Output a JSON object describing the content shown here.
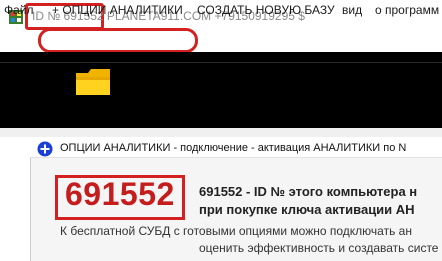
{
  "window": {
    "title": "ID № 691552 PLANETA911.COM +79150919295 $"
  },
  "menu": {
    "items": [
      {
        "label": "Файл"
      },
      {
        "label": "+ ОПЦИИ АНАЛИТИКИ"
      },
      {
        "label": "СОЗДАТЬ НОВУЮ БАЗУ"
      },
      {
        "label": "вид"
      },
      {
        "label": "о программ"
      }
    ]
  },
  "toolbar": {
    "icon": "folder-icon"
  },
  "dialog": {
    "title": "ОПЦИИ АНАЛИТИКИ  -  подключение - активация АНАЛИТИКИ по N",
    "id_value": "691552",
    "line1": "691552 - ID №  этого компьютера н",
    "line2": "при покупке ключа активации АН",
    "line3": "К бесплатной СУБД с готовыми опциями можно подключать ан",
    "line4": "оценить эффективность и создавать систе",
    "icon": "plus-circle-icon"
  },
  "colors": {
    "highlight": "#d32020",
    "id_text": "#c41d1d",
    "toolbar_bg": "#000000",
    "accent_blue": "#1a3fd8"
  }
}
